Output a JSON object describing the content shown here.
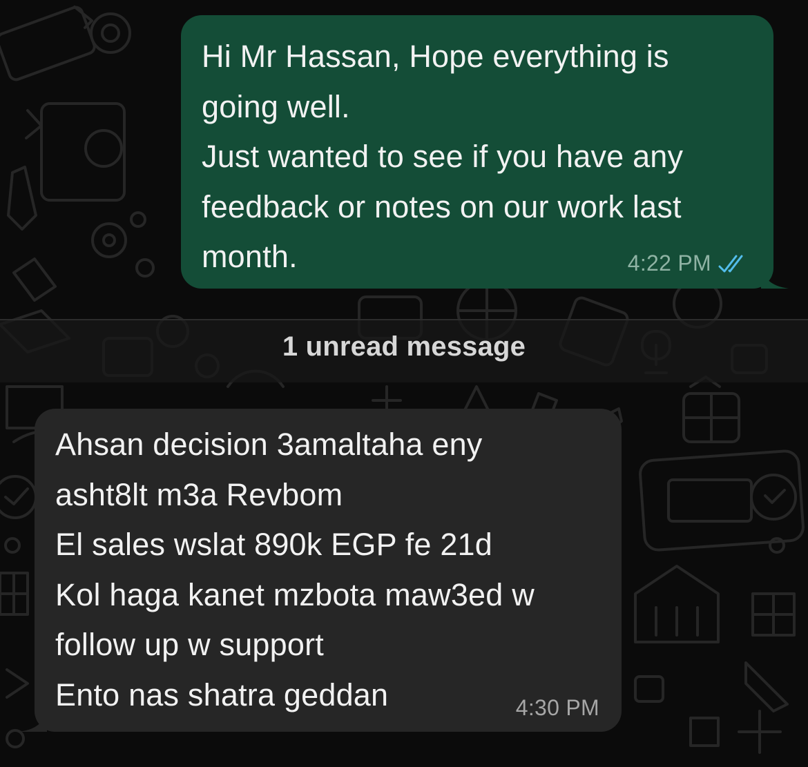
{
  "chat": {
    "outgoing_message": {
      "lines": [
        "Hi Mr Hassan, Hope everything is",
        "going well.",
        "Just wanted to see if you have any",
        "feedback or notes on our work last",
        "month."
      ],
      "time": "4:22 PM",
      "status": "read",
      "status_icon": "double-check-icon",
      "status_color": "#53bdeb"
    },
    "unread_divider": {
      "label": "1 unread message"
    },
    "incoming_message": {
      "lines": [
        "Ahsan decision 3amaltaha eny",
        "asht8lt m3a Revbom",
        "El sales wslat 890k EGP fe 21d",
        "Kol haga kanet mzbota maw3ed w",
        "follow up w support",
        "Ento nas shatra geddan"
      ],
      "time": "4:30 PM"
    }
  },
  "theme": {
    "background": "#0b0b0b",
    "outgoing_bubble": "#144d37",
    "incoming_bubble": "#262626",
    "text": "#f2f2f2"
  }
}
